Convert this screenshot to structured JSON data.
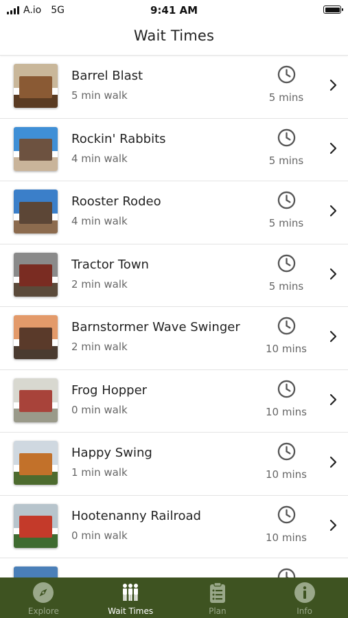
{
  "status_bar": {
    "carrier": "A.io",
    "network": "5G",
    "time": "9:41 AM"
  },
  "header": {
    "title": "Wait Times"
  },
  "rides": [
    {
      "name": "Barrel Blast",
      "walk": "5 min walk",
      "wait": "5 mins",
      "thumb_colors": [
        "#c9b79a",
        "#5a3b22",
        "#8a5a34"
      ]
    },
    {
      "name": "Rockin' Rabbits",
      "walk": "4 min walk",
      "wait": "5 mins",
      "thumb_colors": [
        "#3f8fd6",
        "#c9b49a",
        "#6d5240"
      ]
    },
    {
      "name": "Rooster Rodeo",
      "walk": "4 min walk",
      "wait": "5 mins",
      "thumb_colors": [
        "#3b7fc9",
        "#8c6b4e",
        "#5c4636"
      ]
    },
    {
      "name": "Tractor Town",
      "walk": "2 min walk",
      "wait": "5 mins",
      "thumb_colors": [
        "#8a8a8a",
        "#5b4a3a",
        "#7a2c22"
      ]
    },
    {
      "name": "Barnstormer Wave Swinger",
      "walk": "2 min walk",
      "wait": "10 mins",
      "thumb_colors": [
        "#e39a6a",
        "#4a3b30",
        "#5a3a2a"
      ]
    },
    {
      "name": "Frog Hopper",
      "walk": "0 min walk",
      "wait": "10 mins",
      "thumb_colors": [
        "#d8d8d0",
        "#9a9a8a",
        "#a8433a"
      ]
    },
    {
      "name": "Happy Swing",
      "walk": "1 min walk",
      "wait": "10 mins",
      "thumb_colors": [
        "#cfd8e0",
        "#4d6b2e",
        "#c2712a"
      ]
    },
    {
      "name": "Hootenanny Railroad",
      "walk": "0 min walk",
      "wait": "10 mins",
      "thumb_colors": [
        "#b7c4cc",
        "#3f6b30",
        "#c43a2a"
      ]
    }
  ],
  "tabs": [
    {
      "label": "Explore",
      "icon": "compass-icon"
    },
    {
      "label": "Wait Times",
      "icon": "people-icon"
    },
    {
      "label": "Plan",
      "icon": "clipboard-icon"
    },
    {
      "label": "Info",
      "icon": "info-icon"
    }
  ],
  "colors": {
    "tabbar_bg": "#3e5321",
    "tab_inactive": "#9aa88a",
    "tab_active": "#ffffff"
  }
}
